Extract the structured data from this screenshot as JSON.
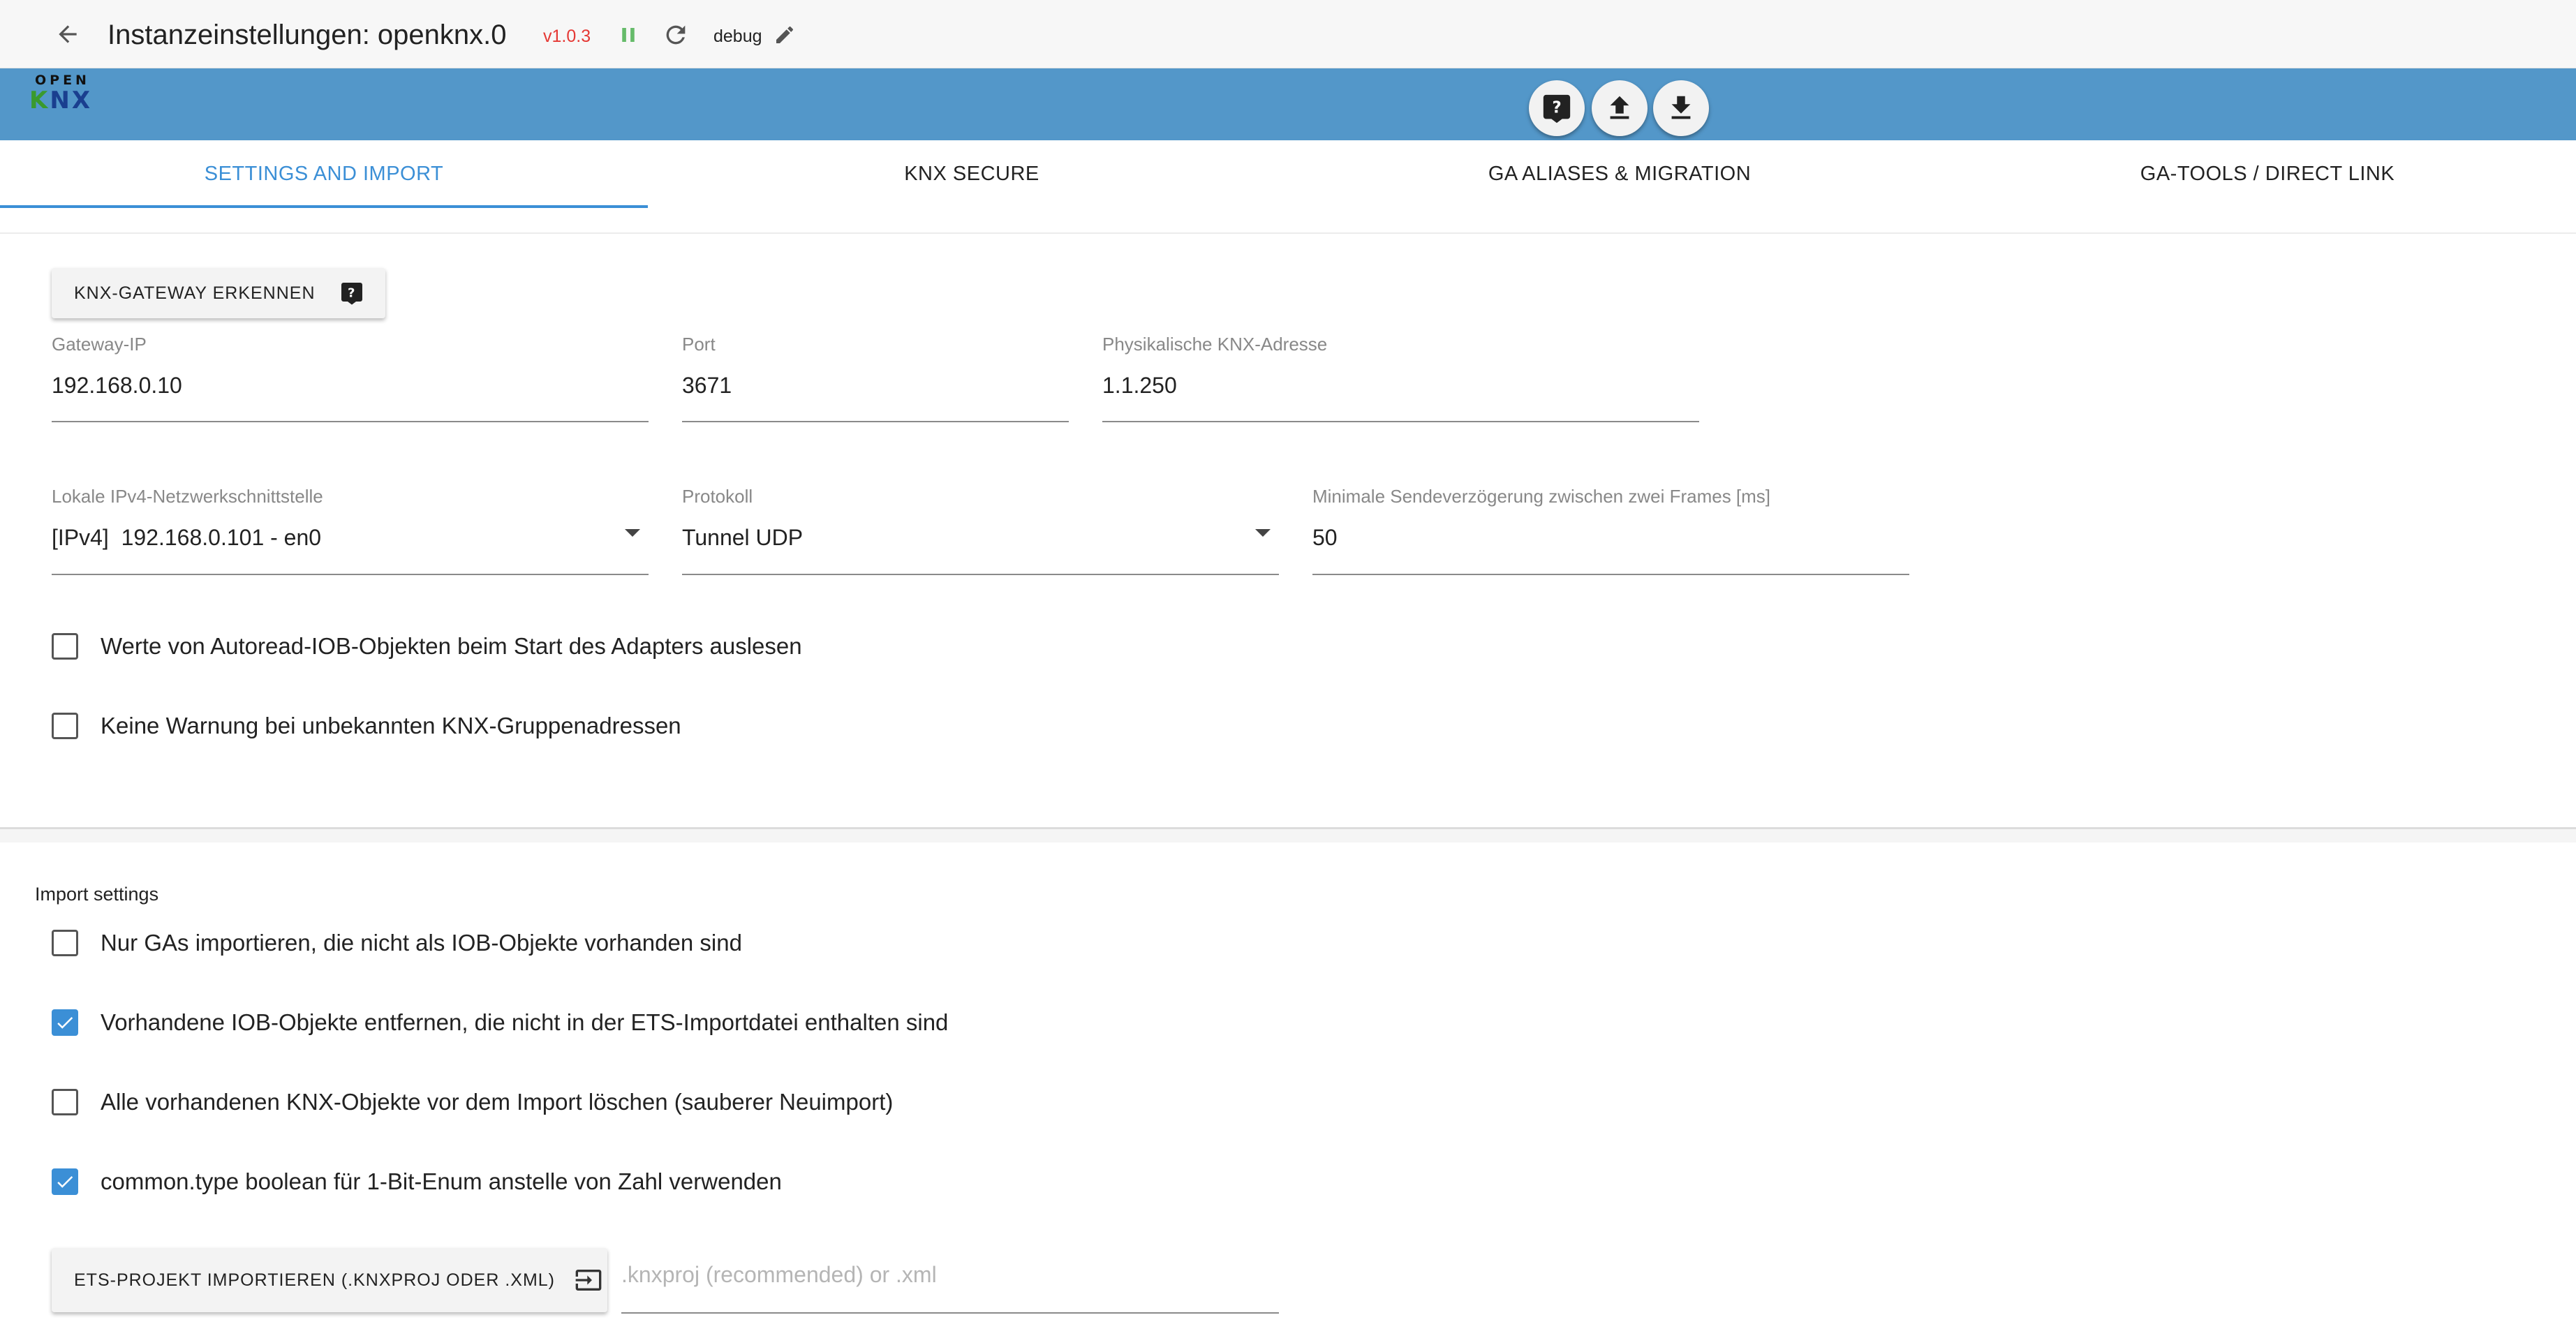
{
  "header": {
    "title": "Instanzeinstellungen: openknx.0",
    "version": "v1.0.3",
    "loglevel": "debug"
  },
  "logo": {
    "open": "OPEN",
    "k": "K",
    "n": "N",
    "x": "X"
  },
  "banner_icons": [
    "help-icon",
    "upload-icon",
    "download-icon"
  ],
  "tabs": [
    {
      "label": "SETTINGS AND IMPORT",
      "active": true
    },
    {
      "label": "KNX SECURE"
    },
    {
      "label": "GA ALIASES & MIGRATION"
    },
    {
      "label": "GA-TOOLS / DIRECT LINK"
    }
  ],
  "settings": {
    "detect_button": "KNX-GATEWAY ERKENNEN",
    "gateway_ip": {
      "label": "Gateway-IP",
      "value": "192.168.0.10"
    },
    "port": {
      "label": "Port",
      "value": "3671"
    },
    "phys_address": {
      "label": "Physikalische KNX-Adresse",
      "value": "1.1.250"
    },
    "local_interface": {
      "label": "Lokale IPv4-Netzwerkschnittstelle",
      "value": "[IPv4]  192.168.0.101 - en0"
    },
    "protocol": {
      "label": "Protokoll",
      "value": "Tunnel UDP"
    },
    "min_delay": {
      "label": "Minimale Sendeverzögerung zwischen zwei Frames [ms]",
      "value": "50"
    },
    "checkboxes": [
      {
        "label": "Werte von Autoread-IOB-Objekten beim Start des Adapters auslesen",
        "checked": false
      },
      {
        "label": "Keine Warnung bei unbekannten KNX-Gruppenadressen",
        "checked": false
      }
    ]
  },
  "import": {
    "heading": "Import settings",
    "checkboxes": [
      {
        "label": "Nur GAs importieren, die nicht als IOB-Objekte vorhanden sind",
        "checked": false
      },
      {
        "label": "Vorhandene IOB-Objekte entfernen, die nicht in der ETS-Importdatei enthalten sind",
        "checked": true
      },
      {
        "label": "Alle vorhandenen KNX-Objekte vor dem Import löschen (sauberer Neuimport)",
        "checked": false
      },
      {
        "label": "common.type boolean für 1-Bit-Enum anstelle von Zahl verwenden",
        "checked": true
      }
    ],
    "import_button": "ETS-PROJEKT IMPORTIEREN (.KNXPROJ ODER .XML)",
    "file_placeholder": ".knxproj (recommended) or .xml"
  },
  "colors": {
    "banner": "#5397c9",
    "accent": "#3b8fd6",
    "version": "#e53935",
    "running": "#66bb6a"
  }
}
